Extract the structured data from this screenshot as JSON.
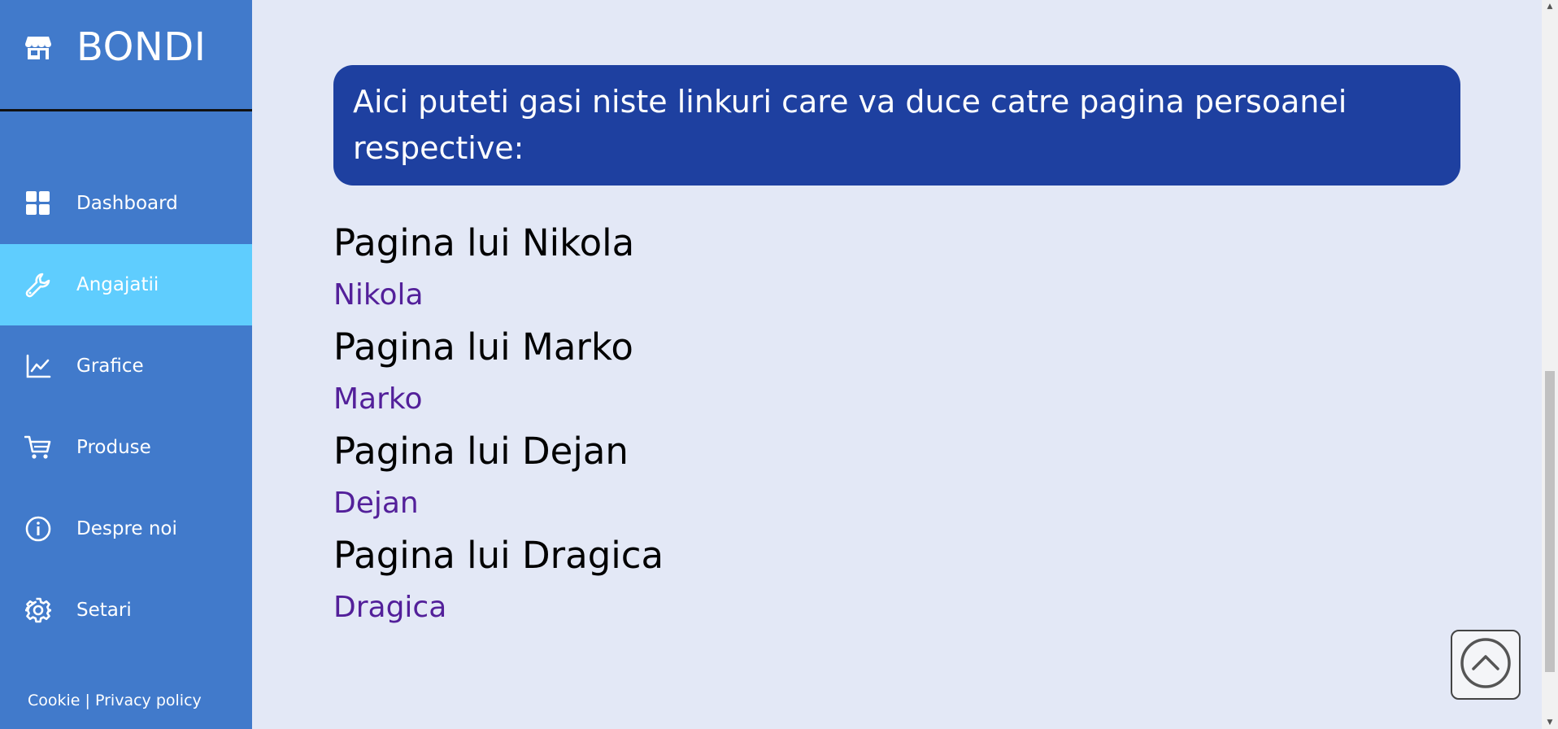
{
  "brand": {
    "title": "BONDI",
    "icon": "store-icon"
  },
  "sidebar": {
    "items": [
      {
        "label": "Dashboard",
        "icon": "dashboard-grid-icon"
      },
      {
        "label": "Angajatii",
        "icon": "wrench-icon",
        "active": true
      },
      {
        "label": "Grafice",
        "icon": "line-chart-icon"
      },
      {
        "label": "Produse",
        "icon": "cart-icon"
      },
      {
        "label": "Despre noi",
        "icon": "info-icon"
      },
      {
        "label": "Setari",
        "icon": "gear-icon"
      }
    ],
    "footer": {
      "cookie": "Cookie",
      "separator": "|",
      "privacy": "Privacy policy"
    }
  },
  "main": {
    "banner": "Aici puteti gasi niste linkuri care va duce catre pagina persoanei respective:",
    "entries": [
      {
        "heading": "Pagina lui Nikola",
        "link": "Nikola"
      },
      {
        "heading": "Pagina lui Marko",
        "link": "Marko"
      },
      {
        "heading": "Pagina lui Dejan",
        "link": "Dejan"
      },
      {
        "heading": "Pagina lui Dragica",
        "link": "Dragica"
      }
    ]
  },
  "colors": {
    "sidebar_bg": "#417acb",
    "active_item": "#5fcdfe",
    "banner_bg": "#1e40a0",
    "page_bg": "#e3e8f6",
    "link": "#53209a"
  }
}
